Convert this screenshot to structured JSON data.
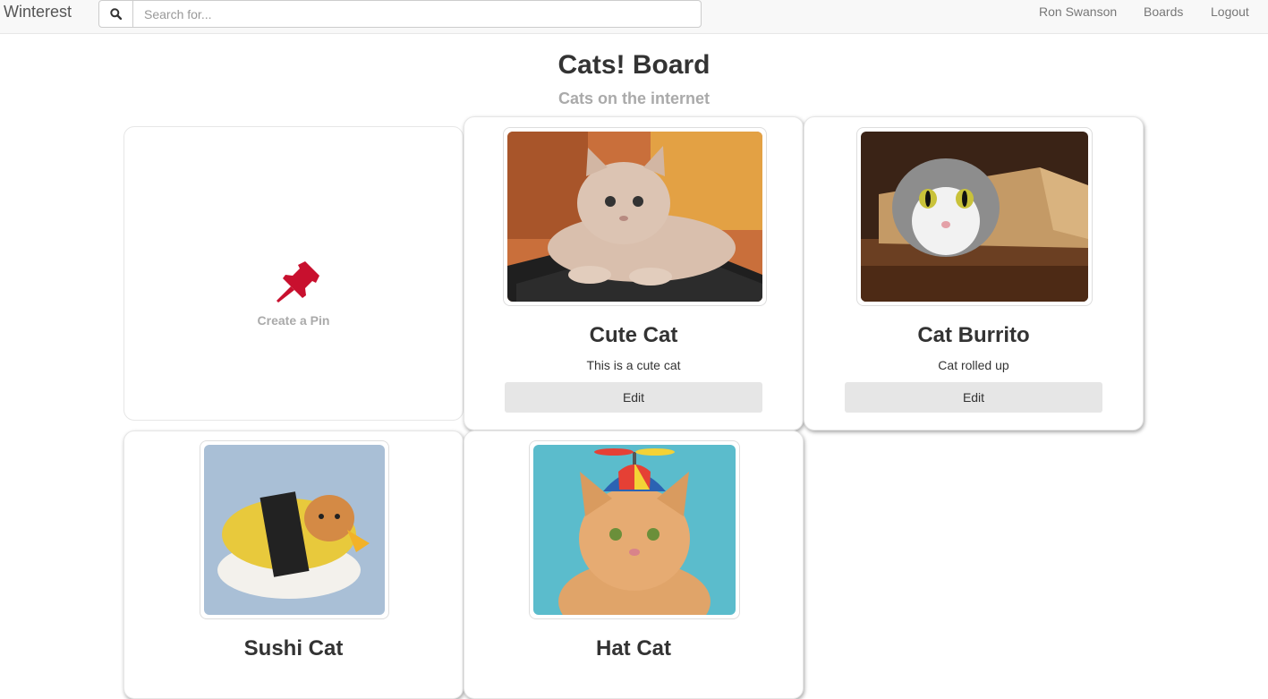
{
  "navbar": {
    "brand": "Winterest",
    "search_placeholder": "Search for...",
    "search_icon": "search-icon",
    "links": [
      "Ron Swanson",
      "Boards",
      "Logout"
    ]
  },
  "board": {
    "title": "Cats! Board",
    "subtitle": "Cats on the internet"
  },
  "create_pin": {
    "label": "Create a Pin",
    "icon": "pushpin-icon",
    "icon_color": "#c8102e"
  },
  "pins": [
    {
      "title": "Cute Cat",
      "description": "This is a cute cat",
      "edit_label": "Edit"
    },
    {
      "title": "Cat Burrito",
      "description": "Cat rolled up",
      "edit_label": "Edit"
    },
    {
      "title": "Sushi Cat"
    },
    {
      "title": "Hat Cat"
    }
  ]
}
